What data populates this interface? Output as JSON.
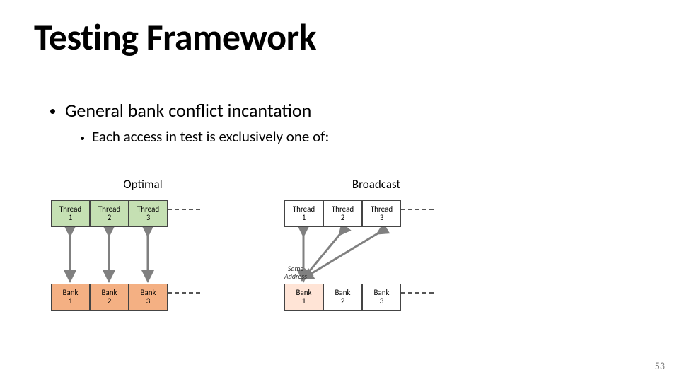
{
  "title": "Testing Framework",
  "bullets": {
    "l1": "General bank conflict incantation",
    "l2": "Each access in test is exclusively one of:"
  },
  "diagrams": {
    "optimal": {
      "label": "Optimal",
      "threads": [
        {
          "top": "Thread",
          "bot": "1"
        },
        {
          "top": "Thread",
          "bot": "2"
        },
        {
          "top": "Thread",
          "bot": "3"
        }
      ],
      "banks": [
        {
          "top": "Bank",
          "bot": "1"
        },
        {
          "top": "Bank",
          "bot": "2"
        },
        {
          "top": "Bank",
          "bot": "3"
        }
      ]
    },
    "broadcast": {
      "label": "Broadcast",
      "threads": [
        {
          "top": "Thread",
          "bot": "1"
        },
        {
          "top": "Thread",
          "bot": "2"
        },
        {
          "top": "Thread",
          "bot": "3"
        }
      ],
      "same_addr": {
        "l1": "Same",
        "l2": "Address"
      },
      "banks": [
        {
          "top": "Bank",
          "bot": "1"
        },
        {
          "top": "Bank",
          "bot": "2"
        },
        {
          "top": "Bank",
          "bot": "3"
        }
      ]
    }
  },
  "page_number": "53"
}
